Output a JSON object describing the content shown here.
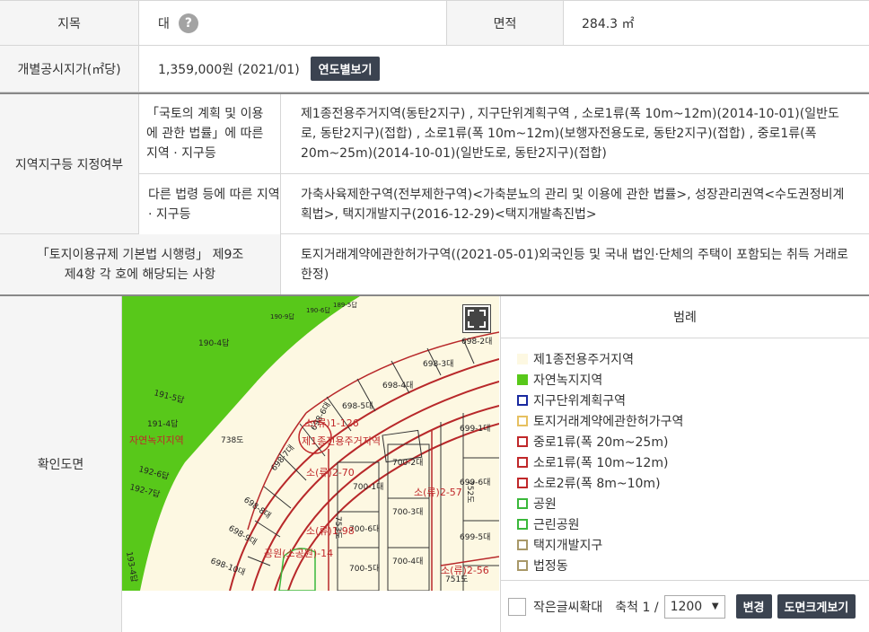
{
  "rows": {
    "jimok": {
      "label": "지목",
      "value": "대",
      "help": "?",
      "area_label": "면적",
      "area_value": "284.3 ㎡"
    },
    "price": {
      "label": "개별공시지가(㎡당)",
      "value": "1,359,000원 (2021/01)",
      "button": "연도별보기"
    },
    "zone": {
      "label": "지역지구등 지정여부",
      "sub1_label": "「국토의 계획 및 이용에 관한 법률」에 따른 지역 · 지구등",
      "sub1_value": "제1종전용주거지역(동탄2지구) , 지구단위계획구역 , 소로1류(폭 10m~12m)(2014-10-01)(일반도로, 동탄2지구)(접합) , 소로1류(폭 10m~12m)(보행자전용도로, 동탄2지구)(접합) , 중로1류(폭 20m~25m)(2014-10-01)(일반도로, 동탄2지구)(접합)",
      "sub2_label": "다른 법령 등에 따른 지역 · 지구등",
      "sub2_value": "가축사육제한구역(전부제한구역)<가축분뇨의 관리 및 이용에 관한 법률>, 성장관리권역<수도권정비계획법>, 택지개발지구(2016-12-29)<택지개발촉진법>"
    },
    "regulation": {
      "label": "「토지이용규제 기본법 시행령」 제9조 제4항 각 호에 해당되는 사항",
      "value": "토지거래계약에관한허가구역((2021-05-01)외국인등 및 국내 법인·단체의 주택이 포함되는 취득 거래로 한정)"
    },
    "map": {
      "label": "확인도면"
    }
  },
  "map_labels": {
    "p190_4": "190-4답",
    "p191_5": "191-5답",
    "p191_4": "191-4답",
    "p192_6": "192-6답",
    "p192_7": "192-7답",
    "p193_4": "193-4답",
    "p738": "738도",
    "p189_5": "189-5답",
    "p190_6": "190-6답",
    "p190_9": "190-9답",
    "p698_2": "698-2대",
    "p698_3": "698-3대",
    "p698_4": "698-4대",
    "p698_5": "698-5대",
    "p698_6": "698-6대",
    "p698_7": "698-7대",
    "p698_8": "698-8대",
    "p698_9": "698-9대",
    "p698_10": "698-10대",
    "p699_1": "699-1대",
    "p699_5": "699-5대",
    "p699_6": "699-6대",
    "p700_1": "700-1대",
    "p700_2": "700-2대",
    "p700_3": "700-3대",
    "p700_4": "700-4대",
    "p700_5": "700-5대",
    "p700_6": "700-6대",
    "p752": "752도",
    "p751": "751도",
    "p753": "753도",
    "z_green": "자연녹지지역",
    "z_res": "제1종전용주거지역",
    "r126": "소(류)1-126",
    "r70": "소(류)2-70",
    "r57": "소(류)2-57",
    "r98": "소(류)1-98",
    "r56": "소(류)2-56",
    "park": "공원(소공원)-14"
  },
  "legend": {
    "title": "범례",
    "items": [
      {
        "label": "제1종전용주거지역",
        "color": "#fdf8e2",
        "border": "#fdf8e2"
      },
      {
        "label": "자연녹지지역",
        "color": "#58c81a",
        "border": "#58c81a"
      },
      {
        "label": "지구단위계획구역",
        "color": "#ffffff",
        "border": "#1a2aa0"
      },
      {
        "label": "토지거래계약에관한허가구역",
        "color": "#ffffff",
        "border": "#e6c060"
      },
      {
        "label": "중로1류(폭 20m~25m)",
        "color": "#ffffff",
        "border": "#c0282a"
      },
      {
        "label": "소로1류(폭 10m~12m)",
        "color": "#ffffff",
        "border": "#c0282a"
      },
      {
        "label": "소로2류(폭 8m~10m)",
        "color": "#ffffff",
        "border": "#c0282a"
      },
      {
        "label": "공원",
        "color": "#ffffff",
        "border": "#3ab83a"
      },
      {
        "label": "근린공원",
        "color": "#ffffff",
        "border": "#3ab83a"
      },
      {
        "label": "택지개발지구",
        "color": "#ffffff",
        "border": "#a89868"
      },
      {
        "label": "법정동",
        "color": "#ffffff",
        "border": "#a89868"
      }
    ],
    "small_text_label": "작은글씨확대",
    "scale_label": "축척 1 /",
    "scale_value": "1200",
    "change_button": "변경",
    "enlarge_button": "도면크게보기"
  }
}
